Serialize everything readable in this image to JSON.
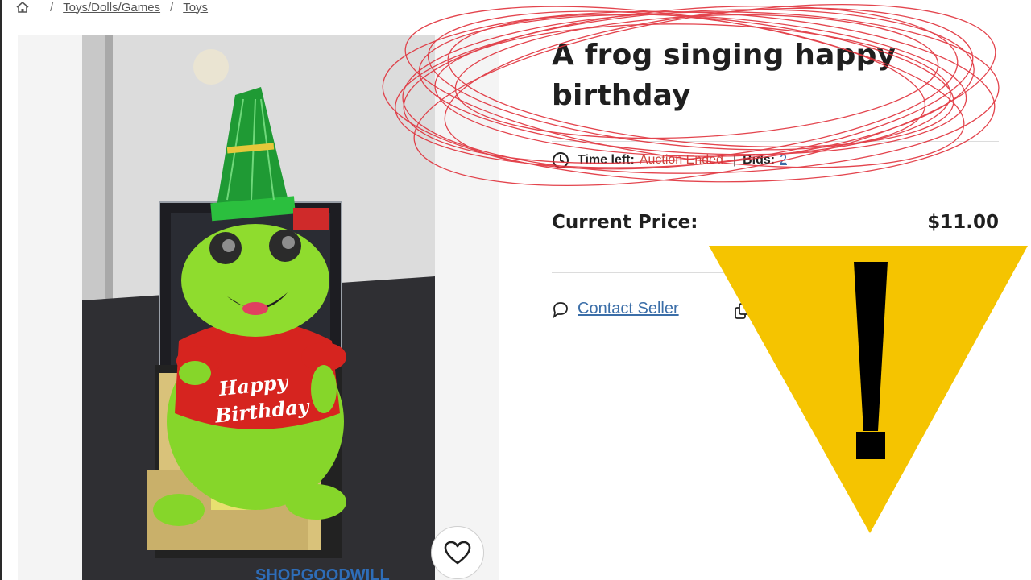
{
  "breadcrumb": {
    "home_icon": "home-icon",
    "items": [
      "Toys/Dolls/Games",
      "Toys"
    ]
  },
  "product": {
    "title": "A frog singing happy birthday",
    "time_left_label": "Time left:",
    "time_left_value": "Auction Ended",
    "bids_label": "Bids:",
    "bids_value": "2",
    "price_label": "Current Price:",
    "price_value": "$11.00"
  },
  "actions": {
    "contact_label": "Contact Seller",
    "contact_icon": "chat-icon",
    "share_icon": "copy-icon"
  },
  "image": {
    "shirt_text_1": "Happy",
    "shirt_text_2": "Birthday",
    "watermark": "SHOPGOODWILL"
  },
  "favorite_icon": "heart-icon",
  "colors": {
    "link": "#3b6ea8",
    "ended": "#c9453c",
    "scribble": "#e0303a",
    "warning": "#f5c400"
  }
}
